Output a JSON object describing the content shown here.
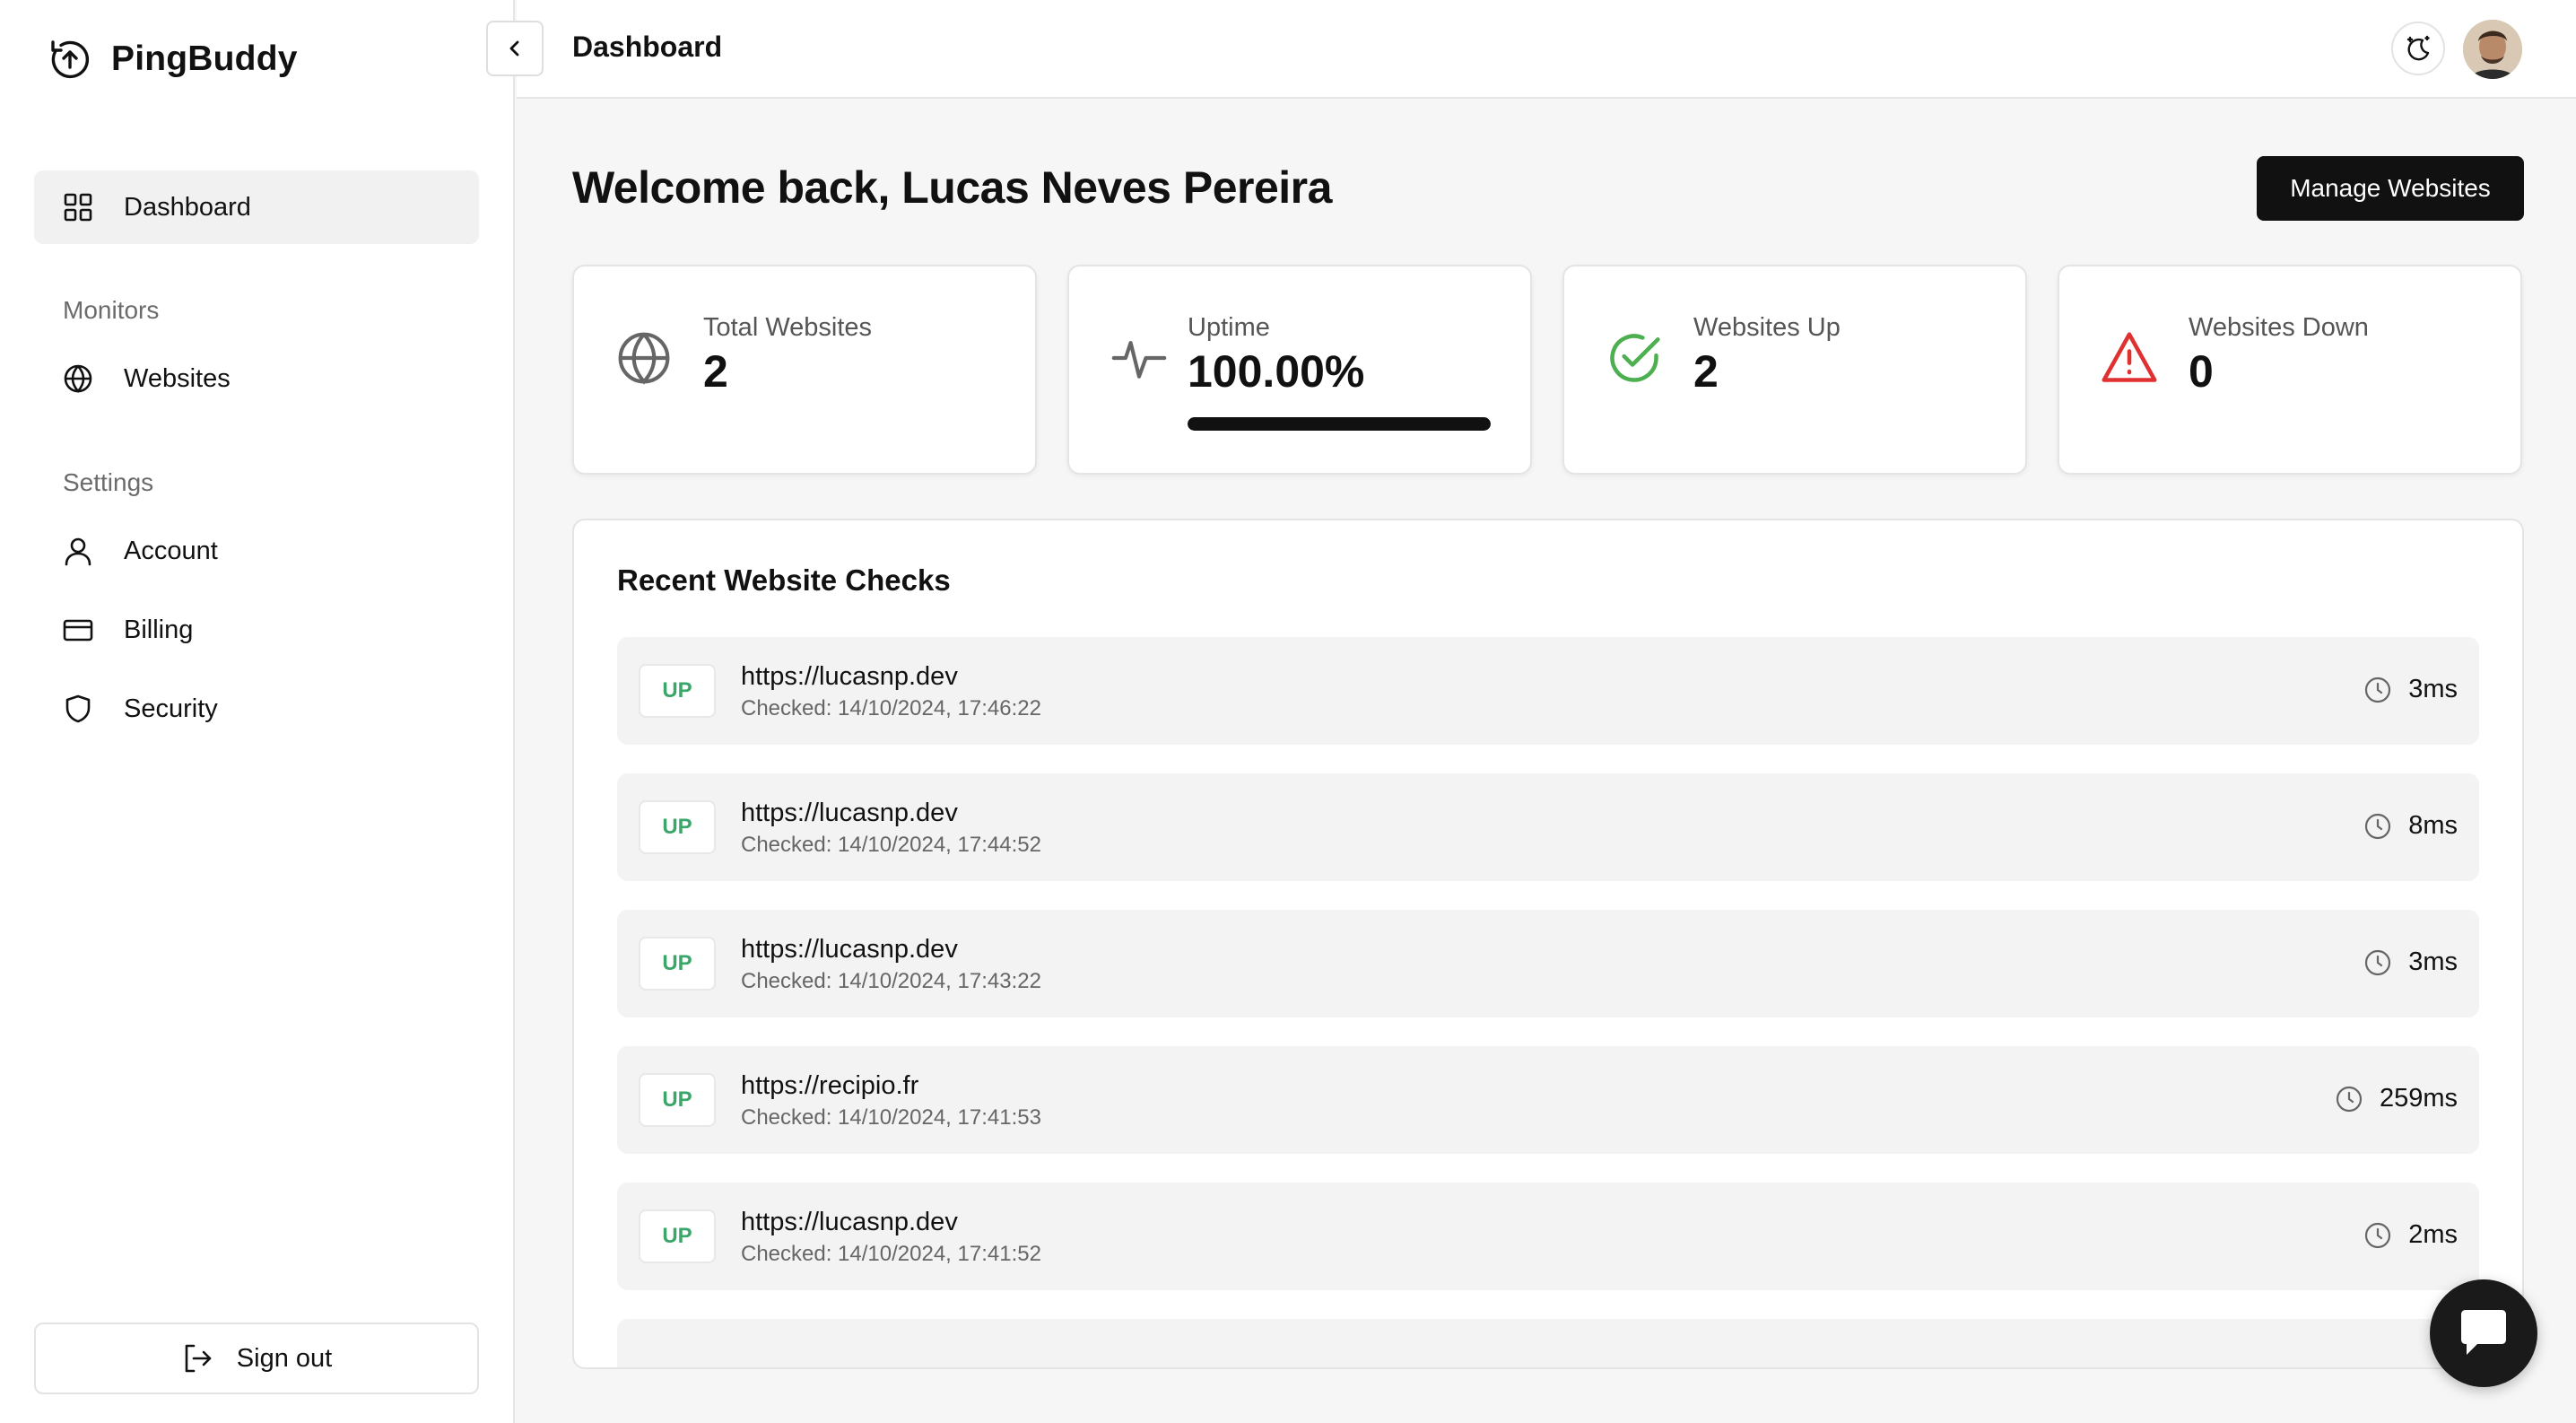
{
  "app": {
    "name": "PingBuddy"
  },
  "sidebar": {
    "dashboard_label": "Dashboard",
    "monitors_heading": "Monitors",
    "websites_label": "Websites",
    "settings_heading": "Settings",
    "account_label": "Account",
    "billing_label": "Billing",
    "security_label": "Security",
    "signout_label": "Sign out"
  },
  "header": {
    "title": "Dashboard"
  },
  "main": {
    "welcome": "Welcome back, Lucas Neves Pereira",
    "manage_label": "Manage Websites"
  },
  "stats": {
    "total": {
      "label": "Total Websites",
      "value": "2"
    },
    "uptime": {
      "label": "Uptime",
      "value": "100.00%",
      "progress_fraction": 1.0
    },
    "up": {
      "label": "Websites Up",
      "value": "2"
    },
    "down": {
      "label": "Websites Down",
      "value": "0"
    }
  },
  "checks": {
    "title": "Recent Website Checks",
    "rows": [
      {
        "status": "UP",
        "url": "https://lucasnp.dev",
        "checked": "Checked: 14/10/2024, 17:46:22",
        "response": "3ms"
      },
      {
        "status": "UP",
        "url": "https://lucasnp.dev",
        "checked": "Checked: 14/10/2024, 17:44:52",
        "response": "8ms"
      },
      {
        "status": "UP",
        "url": "https://lucasnp.dev",
        "checked": "Checked: 14/10/2024, 17:43:22",
        "response": "3ms"
      },
      {
        "status": "UP",
        "url": "https://recipio.fr",
        "checked": "Checked: 14/10/2024, 17:41:53",
        "response": "259ms"
      },
      {
        "status": "UP",
        "url": "https://lucasnp.dev",
        "checked": "Checked: 14/10/2024, 17:41:52",
        "response": "2ms"
      }
    ]
  },
  "colors": {
    "accent": "#111111",
    "status_up": "#3aa66a",
    "status_check": "#4caf50",
    "status_down": "#e03131"
  }
}
